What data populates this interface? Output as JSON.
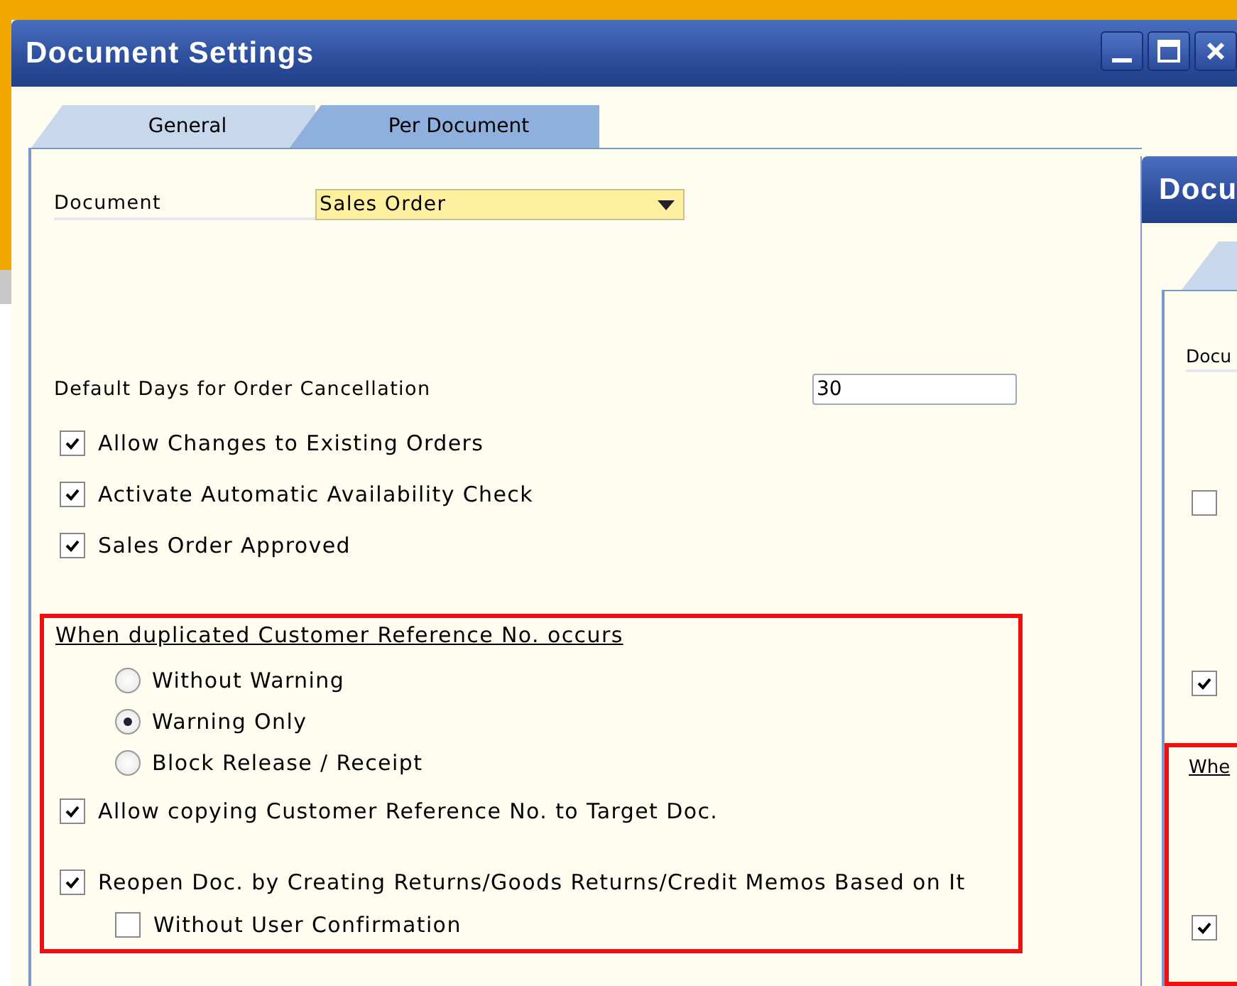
{
  "window": {
    "title": "Document Settings",
    "controls": [
      {
        "kind": "minimize"
      },
      {
        "kind": "maximize"
      },
      {
        "kind": "close"
      }
    ]
  },
  "tabs": [
    {
      "label": "General",
      "selected": false
    },
    {
      "label": "Per Document",
      "selected": true
    }
  ],
  "document": {
    "label": "Document",
    "value": "Sales Order"
  },
  "cancellation": {
    "label": "Default Days for Order Cancellation",
    "value": "30"
  },
  "options": [
    {
      "label": "Allow Changes to Existing Orders",
      "checked": true
    },
    {
      "label": "Activate Automatic Availability Check",
      "checked": true
    },
    {
      "label": "Sales Order Approved",
      "checked": true
    }
  ],
  "duplicate_section": {
    "heading": "When duplicated Customer Reference No. occurs",
    "radios": [
      {
        "label": "Without Warning",
        "selected": false
      },
      {
        "label": "Warning Only",
        "selected": true
      },
      {
        "label": "Block Release / Receipt",
        "selected": false
      }
    ],
    "options": [
      {
        "label": "Allow copying Customer Reference No. to Target Doc.",
        "checked": true,
        "kind": "main"
      },
      {
        "label": "Reopen Doc. by Creating Returns/Goods Returns/Credit Memos Based on It",
        "checked": true,
        "kind": "main"
      },
      {
        "label": "Without User Confirmation",
        "checked": false,
        "kind": "sub"
      }
    ]
  },
  "second_window": {
    "title": "Docu",
    "field_label": "Docu",
    "checkboxes": [
      {
        "checked": false
      },
      {
        "checked": true
      }
    ],
    "section_heading": "Whe",
    "section_checkbox": {
      "checked": true
    }
  }
}
